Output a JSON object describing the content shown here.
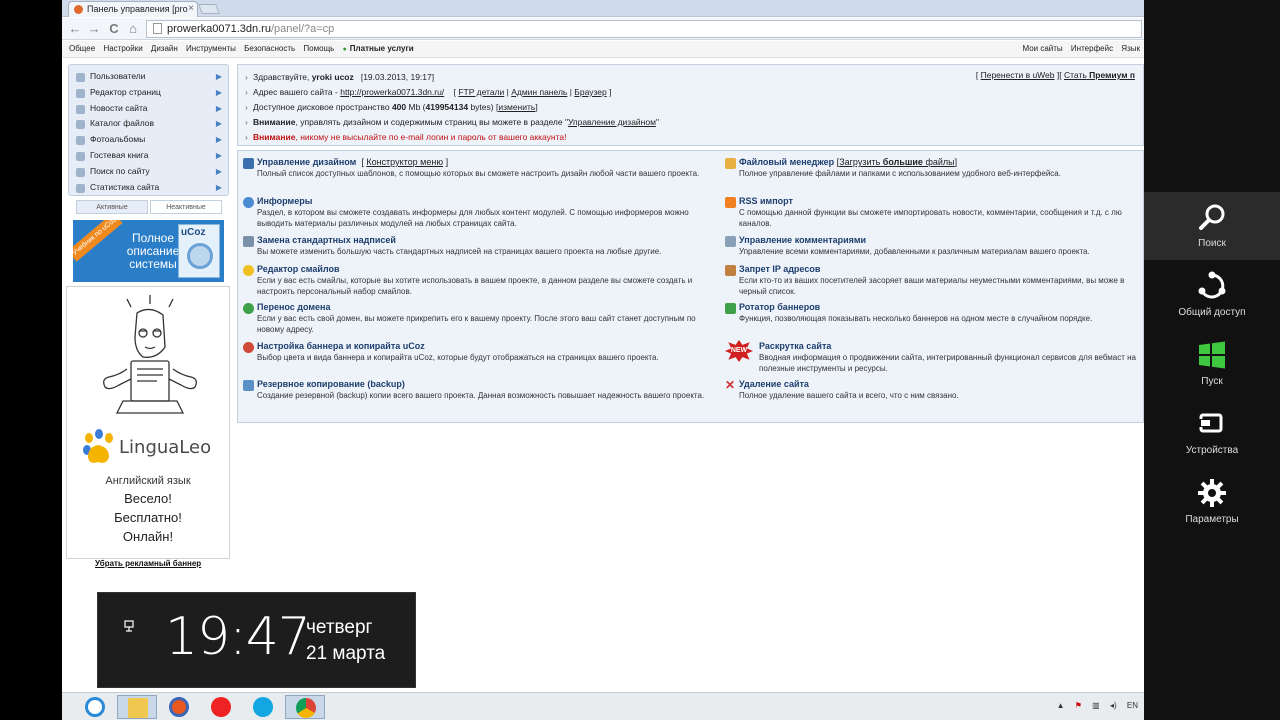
{
  "browser": {
    "tab_title": "Панель управления [pro",
    "tab_close": "×",
    "url_domain": "prowerka0071.3dn.ru",
    "url_path": "/panel/?a=cp",
    "nav_back": "←",
    "nav_forward": "→",
    "nav_reload": "C",
    "nav_home": "⌂"
  },
  "menubar": {
    "left": [
      "Общее",
      "Настройки",
      "Дизайн",
      "Инструменты",
      "Безопасность",
      "Помощь"
    ],
    "paid": "Платные услуги",
    "right": [
      "Мои сайты",
      "Интерфейс",
      "Язык"
    ]
  },
  "sidebar": {
    "items": [
      {
        "label": "Пользователи"
      },
      {
        "label": "Редактор страниц"
      },
      {
        "label": "Новости сайта"
      },
      {
        "label": "Каталог файлов"
      },
      {
        "label": "Фотоальбомы"
      },
      {
        "label": "Гостевая книга"
      },
      {
        "label": "Поиск по сайту"
      },
      {
        "label": "Статистика сайта"
      }
    ],
    "tab_active": "Активные",
    "tab_inactive": "Неактивные",
    "ucoz_banner": {
      "ribbon": "Учебник по uCoz",
      "text": "Полное описание системы",
      "logo": "uCoz"
    },
    "ad": {
      "brand": "LinguaLeo",
      "language": "Английский язык",
      "line1": "Весело!",
      "line2": "Бесплатно!",
      "line3": "Онлайн!"
    },
    "remove_ad": "Убрать рекламный баннер"
  },
  "info": {
    "greeting_prefix": "Здравствуйте,",
    "user": "yroki ucoz",
    "datetime": "[19.03.2013, 19:17]",
    "address_label": "Адрес вашего сайта -",
    "address_link": "http://prowerka0071.3dn.ru/",
    "ftp_link": "FTP детали",
    "admin_link": "Админ панель",
    "browser_link": "Браузер",
    "disk_label": "Доступное дисковое пространство",
    "disk_mb": "400",
    "disk_mb_unit": "Mb",
    "disk_bytes": "419954134",
    "disk_bytes_unit": "bytes)",
    "disk_change": "изменить",
    "warn1_title": "Внимание",
    "warn1_text": ", управлять дизайном и содержимым страниц вы можете в разделе \"",
    "warn1_link": "Управление дизайном",
    "warn2_title": "Внимание",
    "warn2_text": ", никому не высылайте по e-mail логин и пароль от вашего аккаунта!",
    "right_link1": "Перенести в uWeb",
    "right_link2_prefix": "Стать",
    "right_link2_bold": "Премиум п"
  },
  "features": {
    "left": [
      {
        "title": "Управление дизайном",
        "sub": "Конструктор меню",
        "text": "Полный список доступных шаблонов, с помощью которых вы сможете настроить дизайн любой части вашего проекта.",
        "color": "#3c6fb0"
      },
      {
        "title": "Информеры",
        "sub": "",
        "text": "Раздел, в котором вы сможете создавать информеры для любых контент модулей. С помощью информеров можно выводить материалы различных модулей на любых страницах сайта.",
        "color": "#4a8ad0"
      },
      {
        "title": "Замена стандартных надписей",
        "sub": "",
        "text": "Вы можете изменить большую часть стандартных надписей на страницах вашего проекта на любые другие.",
        "color": "#7a8fa8"
      },
      {
        "title": "Редактор смайлов",
        "sub": "",
        "text": "Если у вас есть смайлы, которые вы хотите использовать в вашем проекте, в данном разделе вы сможете создать и настроить персональный набор смайлов.",
        "color": "#f0c020"
      },
      {
        "title": "Перенос домена",
        "sub": "",
        "text": "Если у вас есть свой домен, вы можете прикрепить его к вашему проекту. После этого ваш сайт станет доступным по новому адресу.",
        "color": "#3fa04a"
      },
      {
        "title": "Настройка баннера и копирайта uCoz",
        "sub": "",
        "text": "Выбор цвета и вида баннера и копирайта uCoz, которые будут отображаться на страницах вашего проекта.",
        "color": "#d04a3a"
      },
      {
        "title": "Резервное копирование (backup)",
        "sub": "",
        "text": "Создание резервной (backup) копии всего вашего проекта. Данная возможность повышает надежность вашего проекта.",
        "color": "#5a90c8"
      }
    ],
    "right": [
      {
        "title": "Файловый менеджер",
        "sub_prefix": "Загрузить",
        "sub_bold": "большие",
        "sub_suffix": "файлы",
        "text": "Полное управление файлами и папками с использованием удобного веб-интерфейса.",
        "color": "#e8b040"
      },
      {
        "title": "RSS импорт",
        "text": "С помощью данной функции вы сможете импортировать новости, комментарии, сообщения и т.д. с лю каналов.",
        "color": "#f08020"
      },
      {
        "title": "Управление комментариями",
        "text": "Управление всеми комментариями, добавленными к различным материалам вашего проекта.",
        "color": "#8aa0b8"
      },
      {
        "title": "Запрет IP адресов",
        "text": "Если кто-то из ваших посетителей засоряет ваши материалы неуместными комментариями, вы може в черный список.",
        "color": "#c08040"
      },
      {
        "title": "Ротатор баннеров",
        "text": "Функция, позволяющая показывать несколько баннеров на одном месте в случайном порядке.",
        "color": "#3fa04a"
      },
      {
        "title": "Раскрутка сайта",
        "text": "Вводная информация о продвижении сайта, интегрированный функционал сервисов для вебмаст на полезные инструменты и ресурсы.",
        "color": "#d02020",
        "badge": "NEW"
      },
      {
        "title": "Удаление сайта",
        "text": "Полное удаление вашего сайта и всего, что с ним связано.",
        "color": "#d03030"
      }
    ]
  },
  "clock": {
    "time": "19:47",
    "day": "четверг",
    "date": "21 марта"
  },
  "taskbar": {
    "apps": [
      "internet-explorer",
      "file-explorer",
      "firefox",
      "yandex",
      "skype",
      "chrome"
    ],
    "tray_lang": "EN"
  },
  "charms": [
    {
      "label": "Поиск",
      "icon": "search-icon"
    },
    {
      "label": "Общий доступ",
      "icon": "share-icon"
    },
    {
      "label": "Пуск",
      "icon": "windows-start-icon"
    },
    {
      "label": "Устройства",
      "icon": "devices-icon"
    },
    {
      "label": "Параметры",
      "icon": "settings-gear-icon"
    }
  ]
}
